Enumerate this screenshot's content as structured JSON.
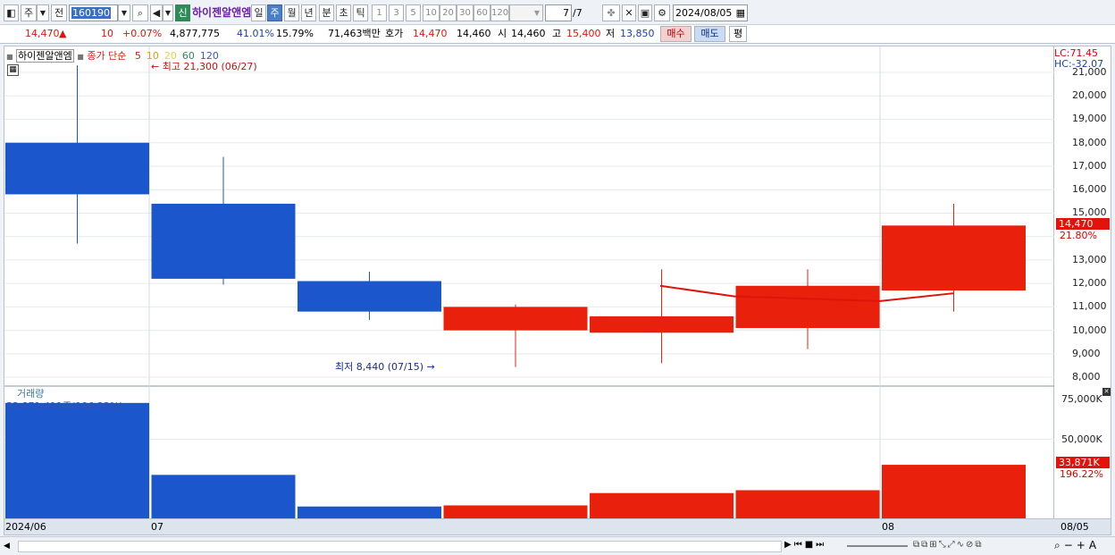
{
  "toolbar": {
    "week_label": "주",
    "prev_label": "전",
    "code": "160190",
    "new_badge": "신",
    "stock_name": "하이젠알앤엠",
    "periods": [
      "일",
      "주",
      "월",
      "년",
      "분",
      "초",
      "틱"
    ],
    "active_period": "주",
    "intervals": [
      "1",
      "3",
      "5",
      "10",
      "20",
      "30",
      "60",
      "120"
    ],
    "page_current": "7",
    "page_total": "/7",
    "date": "2024/08/05"
  },
  "quote": {
    "price": "14,470",
    "up_arrow": "▲",
    "change": "10",
    "change_pct": "+0.07%",
    "volume": "4,877,775",
    "ratio1": "41.01%",
    "ratio2": "15.79%",
    "amount": "71,463백만",
    "bid_label": "호가",
    "bid1": "14,470",
    "bid2": "14,460",
    "open_label": "시",
    "open": "14,460",
    "high_label": "고",
    "high": "15,400",
    "low_label": "저",
    "low": "13,850",
    "buy_label": "매수",
    "sell_label": "매도",
    "avg_label": "평"
  },
  "chart": {
    "legend_name": "하이젠알앤엠",
    "legend_ma_label": "종가 단순",
    "ma_periods": [
      {
        "p": "5",
        "c": "#d81b12"
      },
      {
        "p": "10",
        "c": "#e0a000"
      },
      {
        "p": "20",
        "c": "#ebd23a"
      },
      {
        "p": "60",
        "c": "#2e8b57"
      },
      {
        "p": "120",
        "c": "#3060c0"
      }
    ],
    "high_note": "최고 21,300 (06/27)",
    "low_note": "최저 8,440 (07/15)",
    "lc": "LC:71.45",
    "hc": "HC:-32.07",
    "price_ticks": [
      "21,000",
      "20,000",
      "19,000",
      "18,000",
      "17,000",
      "16,000",
      "15,000",
      "13,000",
      "12,000",
      "11,000",
      "10,000",
      "9,000",
      "8,000"
    ],
    "price_marker": "14,470",
    "price_marker_pct": "21.80%",
    "vol_label": "거래량",
    "vol_note": "33,871,411주(196.22%)",
    "vol_ticks": [
      "75,000K",
      "50,000K"
    ],
    "vol_marker": "33,871K",
    "vol_marker_pct": "196.22%",
    "x_labels": [
      "2024/06",
      "07",
      "08"
    ],
    "x_last": "08/05",
    "colors": {
      "up": "#e8200c",
      "down": "#1c56cc"
    }
  },
  "chart_data": {
    "type": "candlestick",
    "weeks": [
      {
        "open": 18000,
        "close": 15800,
        "high": 21300,
        "low": 13700,
        "volume": 73000000,
        "dir": "down"
      },
      {
        "open": 15400,
        "close": 12200,
        "high": 17400,
        "low": 11950,
        "volume": 27500000,
        "dir": "down"
      },
      {
        "open": 12100,
        "close": 10800,
        "high": 12500,
        "low": 10450,
        "volume": 7500000,
        "dir": "down"
      },
      {
        "open": 11000,
        "close": 10000,
        "high": 11100,
        "low": 8440,
        "volume": 8200000,
        "dir": "up"
      },
      {
        "open": 9900,
        "close": 10600,
        "high": 12600,
        "low": 8600,
        "volume": 16000000,
        "dir": "up"
      },
      {
        "open": 10100,
        "close": 11900,
        "high": 12600,
        "low": 9200,
        "volume": 17800000,
        "dir": "up"
      },
      {
        "open": 11700,
        "close": 14470,
        "high": 15400,
        "low": 10800,
        "volume": 33871411,
        "dir": "up"
      }
    ],
    "ma5": [
      null,
      null,
      null,
      null,
      11900,
      11450,
      11250,
      11580
    ],
    "y_range": [
      7700,
      21800
    ],
    "vol_range": [
      0,
      78000000
    ]
  }
}
